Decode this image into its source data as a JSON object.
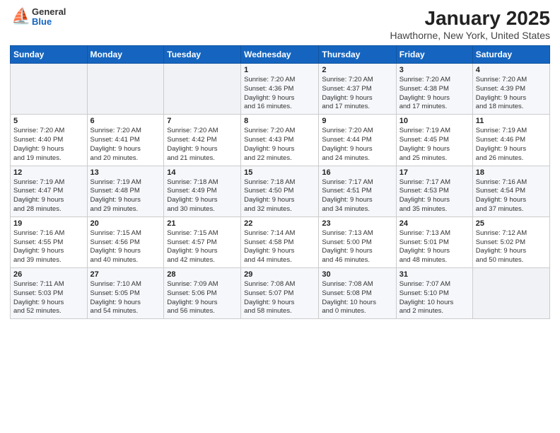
{
  "header": {
    "logo_general": "General",
    "logo_blue": "Blue",
    "month": "January 2025",
    "location": "Hawthorne, New York, United States"
  },
  "days_of_week": [
    "Sunday",
    "Monday",
    "Tuesday",
    "Wednesday",
    "Thursday",
    "Friday",
    "Saturday"
  ],
  "weeks": [
    [
      {
        "day": "",
        "info": ""
      },
      {
        "day": "",
        "info": ""
      },
      {
        "day": "",
        "info": ""
      },
      {
        "day": "1",
        "info": "Sunrise: 7:20 AM\nSunset: 4:36 PM\nDaylight: 9 hours\nand 16 minutes."
      },
      {
        "day": "2",
        "info": "Sunrise: 7:20 AM\nSunset: 4:37 PM\nDaylight: 9 hours\nand 17 minutes."
      },
      {
        "day": "3",
        "info": "Sunrise: 7:20 AM\nSunset: 4:38 PM\nDaylight: 9 hours\nand 17 minutes."
      },
      {
        "day": "4",
        "info": "Sunrise: 7:20 AM\nSunset: 4:39 PM\nDaylight: 9 hours\nand 18 minutes."
      }
    ],
    [
      {
        "day": "5",
        "info": "Sunrise: 7:20 AM\nSunset: 4:40 PM\nDaylight: 9 hours\nand 19 minutes."
      },
      {
        "day": "6",
        "info": "Sunrise: 7:20 AM\nSunset: 4:41 PM\nDaylight: 9 hours\nand 20 minutes."
      },
      {
        "day": "7",
        "info": "Sunrise: 7:20 AM\nSunset: 4:42 PM\nDaylight: 9 hours\nand 21 minutes."
      },
      {
        "day": "8",
        "info": "Sunrise: 7:20 AM\nSunset: 4:43 PM\nDaylight: 9 hours\nand 22 minutes."
      },
      {
        "day": "9",
        "info": "Sunrise: 7:20 AM\nSunset: 4:44 PM\nDaylight: 9 hours\nand 24 minutes."
      },
      {
        "day": "10",
        "info": "Sunrise: 7:19 AM\nSunset: 4:45 PM\nDaylight: 9 hours\nand 25 minutes."
      },
      {
        "day": "11",
        "info": "Sunrise: 7:19 AM\nSunset: 4:46 PM\nDaylight: 9 hours\nand 26 minutes."
      }
    ],
    [
      {
        "day": "12",
        "info": "Sunrise: 7:19 AM\nSunset: 4:47 PM\nDaylight: 9 hours\nand 28 minutes."
      },
      {
        "day": "13",
        "info": "Sunrise: 7:19 AM\nSunset: 4:48 PM\nDaylight: 9 hours\nand 29 minutes."
      },
      {
        "day": "14",
        "info": "Sunrise: 7:18 AM\nSunset: 4:49 PM\nDaylight: 9 hours\nand 30 minutes."
      },
      {
        "day": "15",
        "info": "Sunrise: 7:18 AM\nSunset: 4:50 PM\nDaylight: 9 hours\nand 32 minutes."
      },
      {
        "day": "16",
        "info": "Sunrise: 7:17 AM\nSunset: 4:51 PM\nDaylight: 9 hours\nand 34 minutes."
      },
      {
        "day": "17",
        "info": "Sunrise: 7:17 AM\nSunset: 4:53 PM\nDaylight: 9 hours\nand 35 minutes."
      },
      {
        "day": "18",
        "info": "Sunrise: 7:16 AM\nSunset: 4:54 PM\nDaylight: 9 hours\nand 37 minutes."
      }
    ],
    [
      {
        "day": "19",
        "info": "Sunrise: 7:16 AM\nSunset: 4:55 PM\nDaylight: 9 hours\nand 39 minutes."
      },
      {
        "day": "20",
        "info": "Sunrise: 7:15 AM\nSunset: 4:56 PM\nDaylight: 9 hours\nand 40 minutes."
      },
      {
        "day": "21",
        "info": "Sunrise: 7:15 AM\nSunset: 4:57 PM\nDaylight: 9 hours\nand 42 minutes."
      },
      {
        "day": "22",
        "info": "Sunrise: 7:14 AM\nSunset: 4:58 PM\nDaylight: 9 hours\nand 44 minutes."
      },
      {
        "day": "23",
        "info": "Sunrise: 7:13 AM\nSunset: 5:00 PM\nDaylight: 9 hours\nand 46 minutes."
      },
      {
        "day": "24",
        "info": "Sunrise: 7:13 AM\nSunset: 5:01 PM\nDaylight: 9 hours\nand 48 minutes."
      },
      {
        "day": "25",
        "info": "Sunrise: 7:12 AM\nSunset: 5:02 PM\nDaylight: 9 hours\nand 50 minutes."
      }
    ],
    [
      {
        "day": "26",
        "info": "Sunrise: 7:11 AM\nSunset: 5:03 PM\nDaylight: 9 hours\nand 52 minutes."
      },
      {
        "day": "27",
        "info": "Sunrise: 7:10 AM\nSunset: 5:05 PM\nDaylight: 9 hours\nand 54 minutes."
      },
      {
        "day": "28",
        "info": "Sunrise: 7:09 AM\nSunset: 5:06 PM\nDaylight: 9 hours\nand 56 minutes."
      },
      {
        "day": "29",
        "info": "Sunrise: 7:08 AM\nSunset: 5:07 PM\nDaylight: 9 hours\nand 58 minutes."
      },
      {
        "day": "30",
        "info": "Sunrise: 7:08 AM\nSunset: 5:08 PM\nDaylight: 10 hours\nand 0 minutes."
      },
      {
        "day": "31",
        "info": "Sunrise: 7:07 AM\nSunset: 5:10 PM\nDaylight: 10 hours\nand 2 minutes."
      },
      {
        "day": "",
        "info": ""
      }
    ]
  ]
}
